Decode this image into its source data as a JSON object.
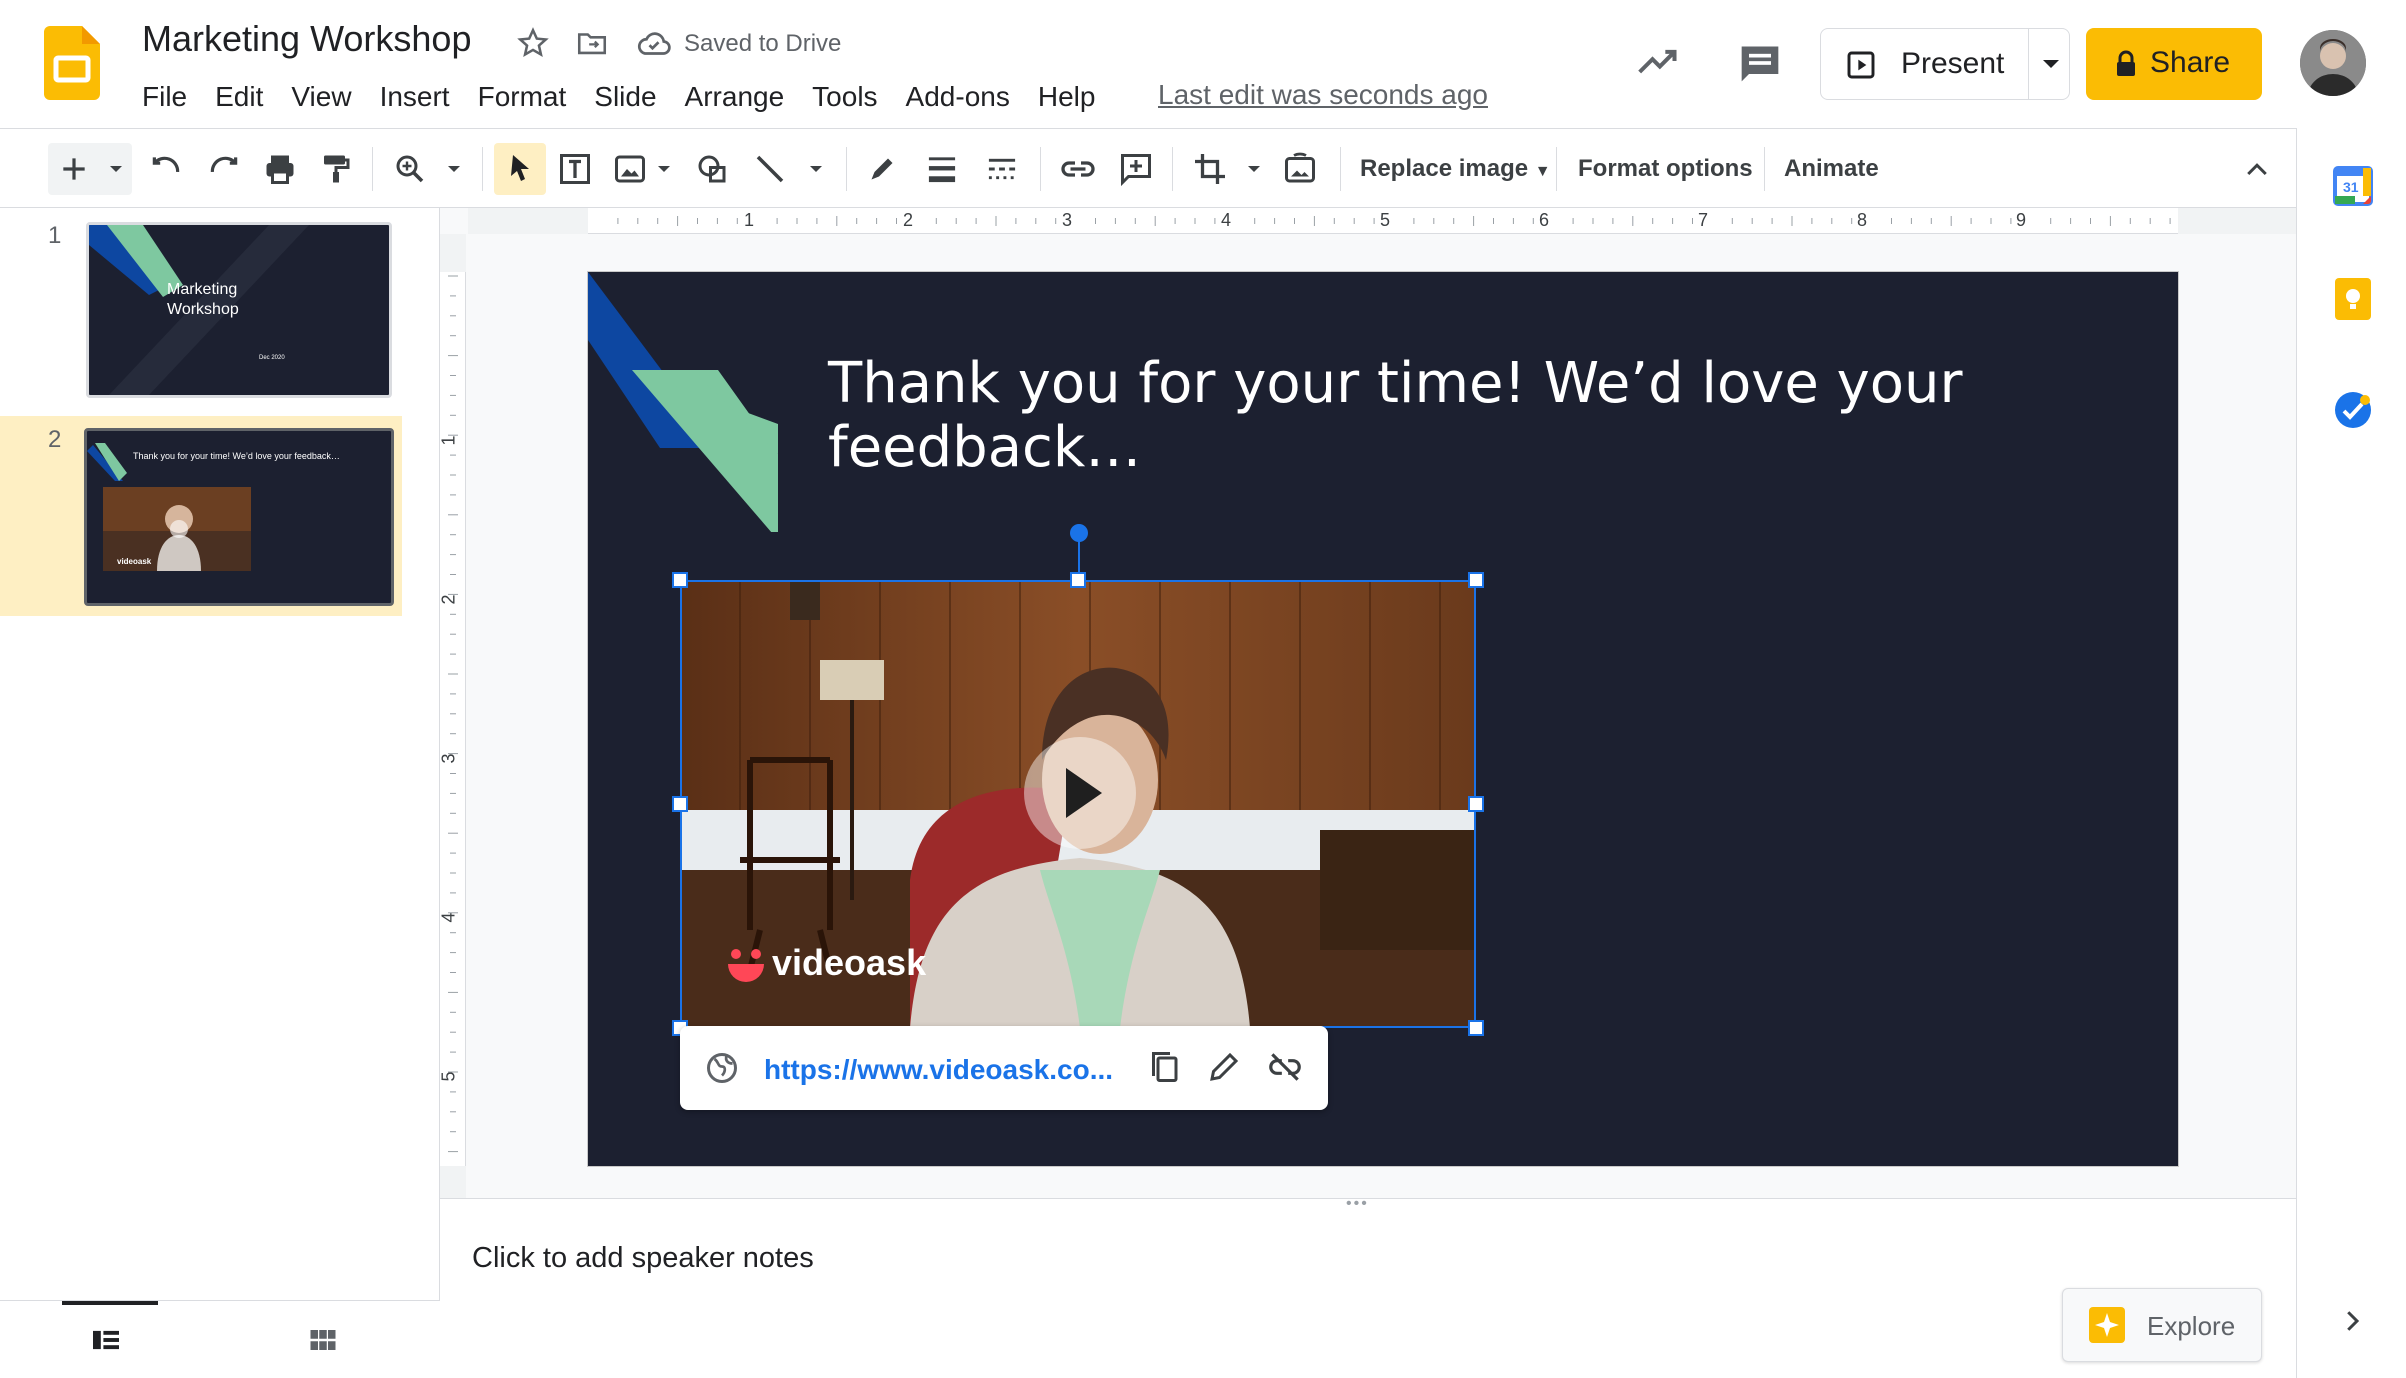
{
  "app": {
    "doc_title": "Marketing Workshop",
    "saved_status": "Saved to Drive",
    "last_edit": "Last edit was seconds ago"
  },
  "menu": [
    {
      "label": "File"
    },
    {
      "label": "Edit"
    },
    {
      "label": "View"
    },
    {
      "label": "Insert"
    },
    {
      "label": "Format"
    },
    {
      "label": "Slide"
    },
    {
      "label": "Arrange"
    },
    {
      "label": "Tools"
    },
    {
      "label": "Add-ons"
    },
    {
      "label": "Help"
    }
  ],
  "header_actions": {
    "present_label": "Present",
    "share_label": "Share"
  },
  "toolbar": {
    "replace_image_label": "Replace image",
    "format_options_label": "Format options",
    "animate_label": "Animate"
  },
  "ruler": {
    "horizontal_labels": [
      "1",
      "2",
      "3",
      "4",
      "5",
      "6",
      "7",
      "8",
      "9"
    ],
    "vertical_labels": [
      "1",
      "2",
      "3",
      "4",
      "5"
    ]
  },
  "filmstrip": {
    "slides": [
      {
        "number": "1",
        "title_line1": "Marketing",
        "title_line2": "Workshop",
        "date": "Dec 2020"
      },
      {
        "number": "2",
        "title": "Thank you for your time! We’d love your feedback…",
        "video_brand": "videoask"
      }
    ]
  },
  "slide": {
    "title": "Thank you for your time! We’d love your feedback…",
    "video_brand": "videoask"
  },
  "link_popup": {
    "url": "https://www.videoask.co..."
  },
  "notes": {
    "placeholder": "Click to add speaker notes"
  },
  "explore": {
    "label": "Explore"
  },
  "side_panel": {
    "calendar_day": "31"
  },
  "colors": {
    "accent": "#1a73e8",
    "share": "#fbbc04",
    "slide_bg": "#1c2030",
    "shape_blue": "#0d47a1",
    "shape_green": "#7ec8a0"
  }
}
